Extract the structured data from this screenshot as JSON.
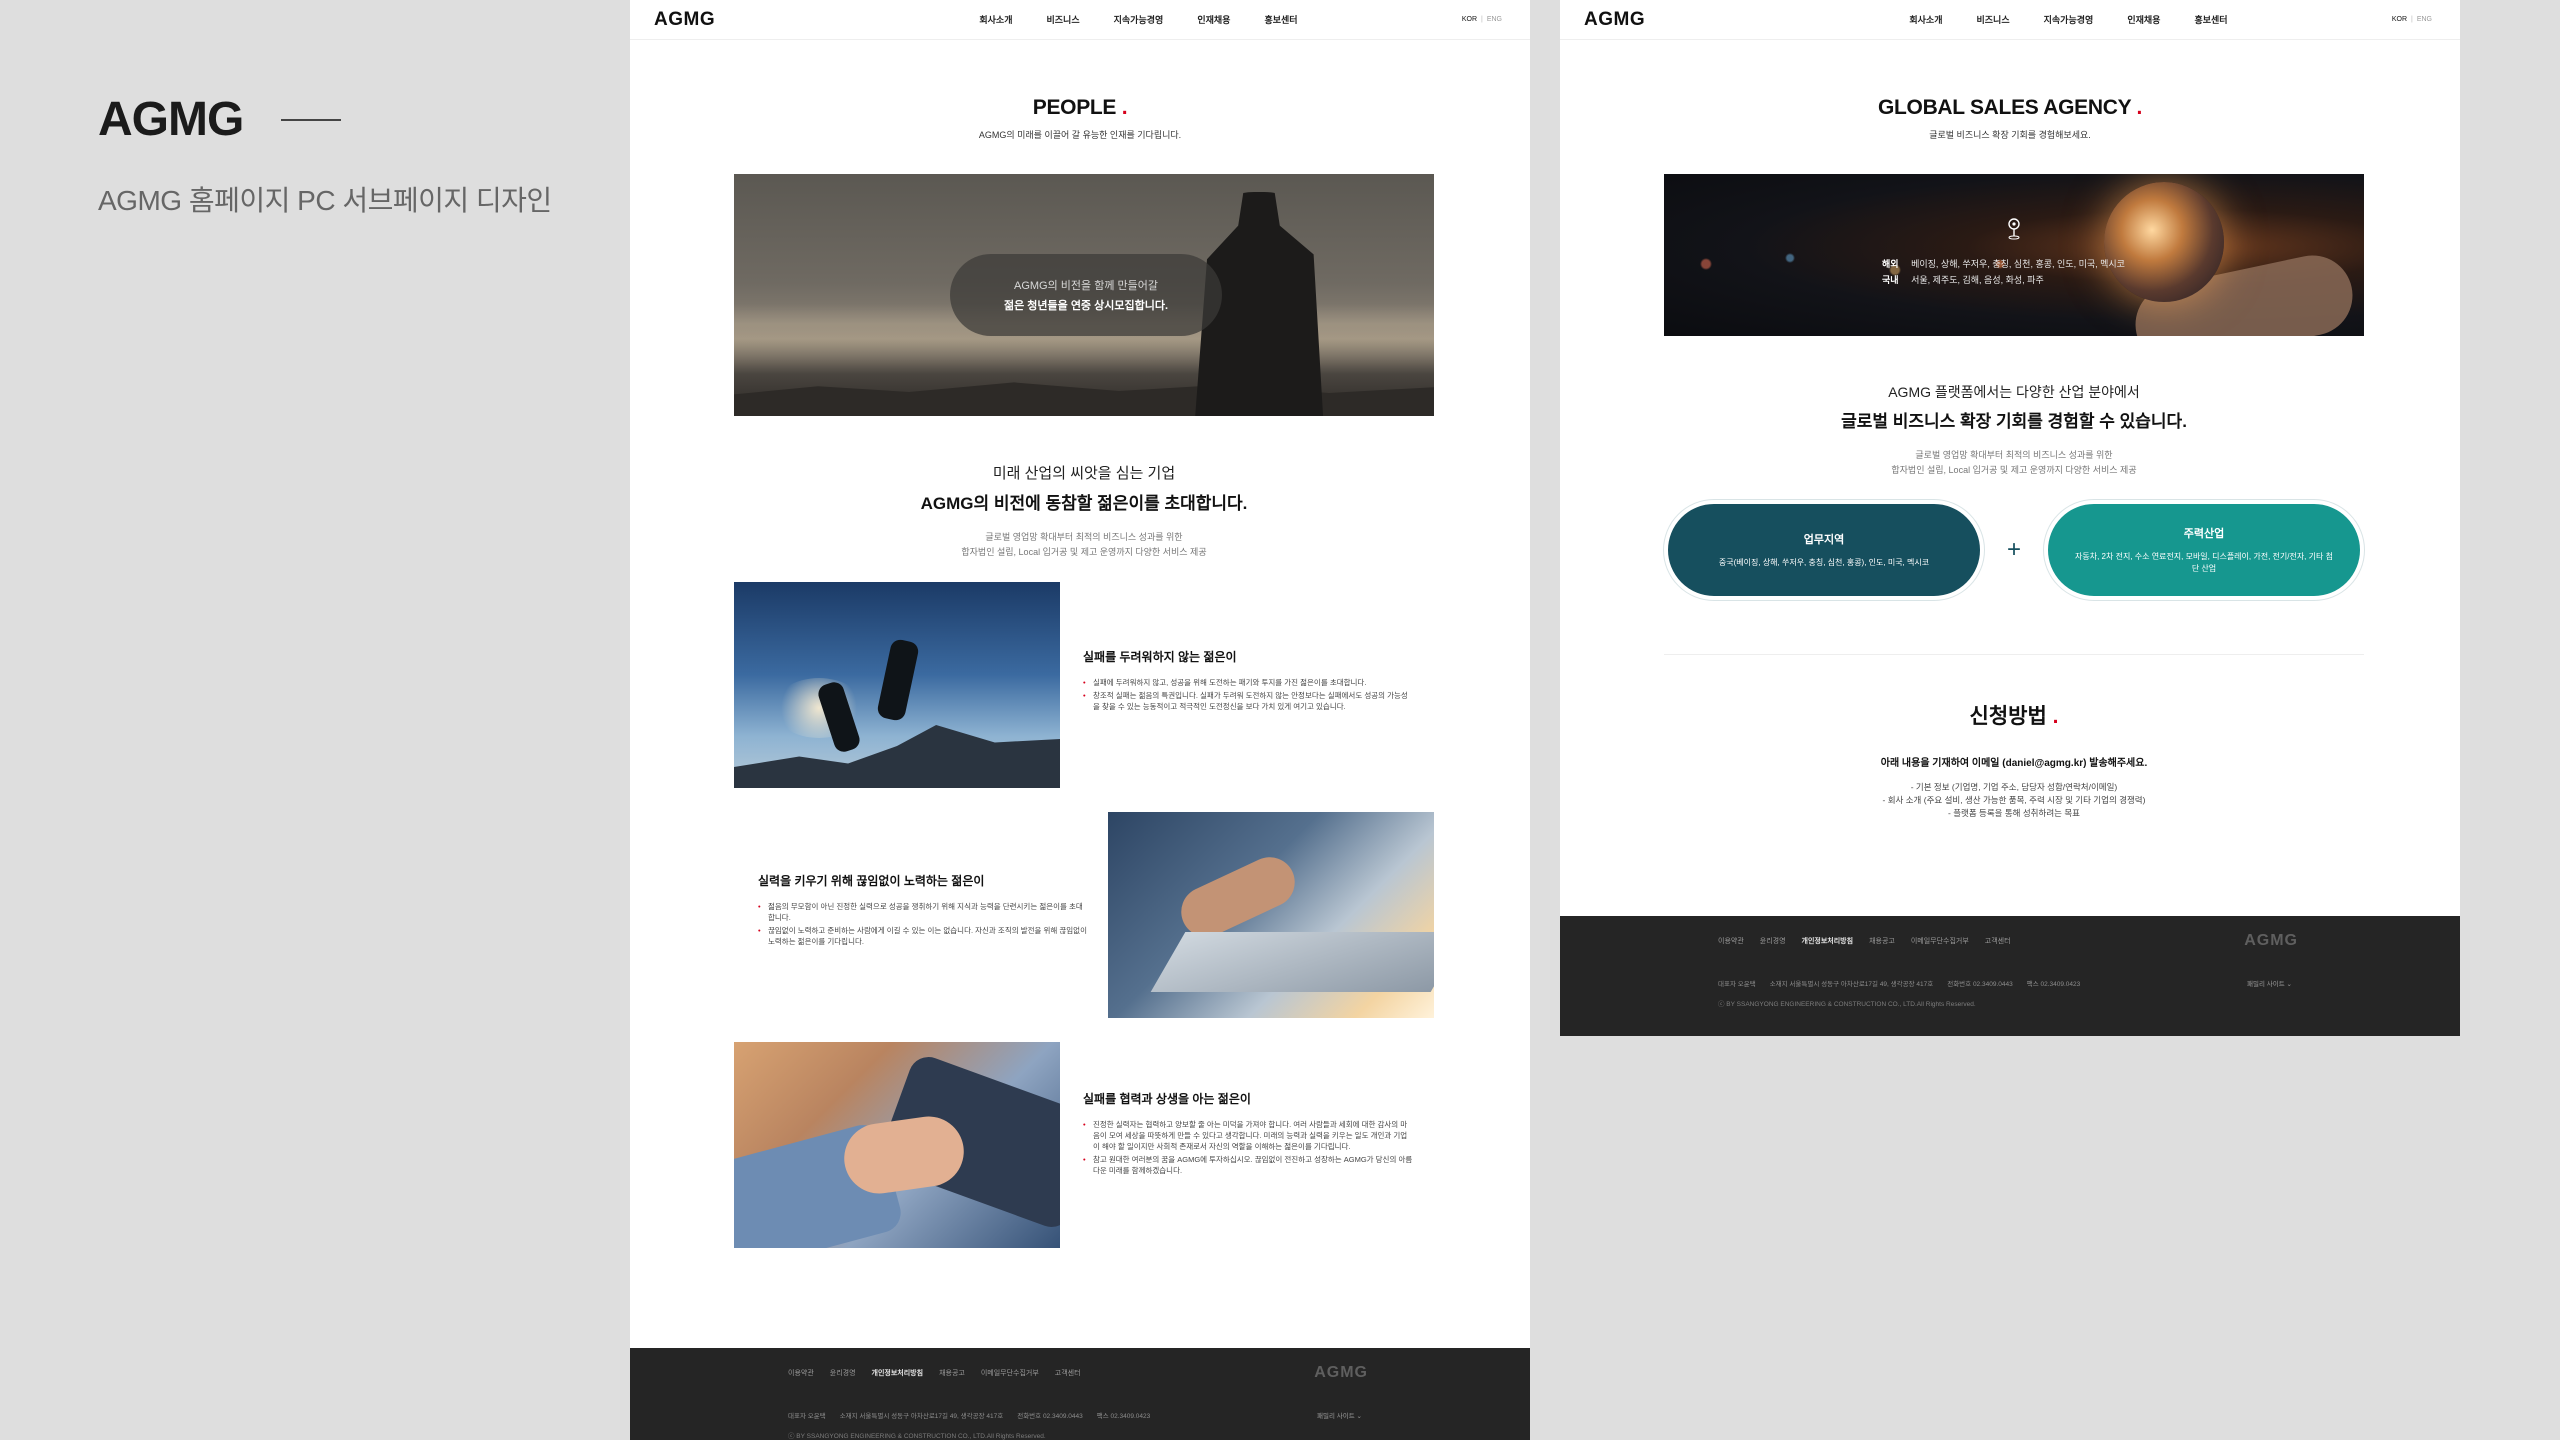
{
  "presentation": {
    "title": "AGMG",
    "subtitle": "AGMG 홈페이지 PC 서브페이지 디자인"
  },
  "header": {
    "logo": "AGMG",
    "nav": [
      "회사소개",
      "비즈니스",
      "지속가능경영",
      "인재채용",
      "홍보센터"
    ],
    "lang_kor": "KOR",
    "lang_sep": "|",
    "lang_eng": "ENG"
  },
  "page1": {
    "title": "PEOPLE",
    "title_dot": ".",
    "subtitle": "AGMG의 미래를 이끌어 갈 유능한 인재를 기다립니다.",
    "hero": {
      "line1": "AGMG의 비전을 함께 만들어갈",
      "line2": "젊은 청년들을 연중 상시모집합니다."
    },
    "intro": {
      "line1": "미래 산업의 씨앗을 심는 기업",
      "line2": "AGMG의 비전에 동참할 젊은이를 초대합니다.",
      "desc1": "글로벌 영업망 확대부터 최적의 비즈니스 성과를 위한",
      "desc2": "합자법인 설립, Local 입거공 및 제고 운영까지 다양한 서비스 제공"
    },
    "features": [
      {
        "title": "실패를 두려워하지 않는 젊은이",
        "bullets": [
          "실패에 두려워하지 않고, 성공을 위해 도전하는 패기와 투지를 가진 젊은이를 초대합니다.",
          "창조적 실패는 젊음의 특권입니다. 실패가 두려워 도전하지 않는 안정보다는 실패에서도 성공의 가능성을 찾을 수 있는 능동적이고 적극적인 도전정신을 보다 가치 있게 여기고 있습니다."
        ]
      },
      {
        "title": "실력을 키우기 위해 끊임없이 노력하는 젊은이",
        "bullets": [
          "젊음의 무모함이 아닌 진정한 실력으로 성공을 쟁취하기 위해 지식과 능력을 단련시키는 젊은이를 초대합니다.",
          "끊임없이 노력하고 준비하는 사람에게 이길 수 있는 이는 없습니다. 자신과 조직의 발전을 위해 끊임없이 노력하는 젊은이를 기다립니다."
        ]
      },
      {
        "title": "실패를 협력과 상생을 아는 젊은이",
        "bullets": [
          "진정한 실력자는 협력하고 양보할 줄 아는 미덕을 가져야 합니다. 여러 사람들과 세회에 대한 감사의 마음이 모여 세상을 따뜻하게 만들 수 있다고 생각합니다. 미래의 능력과 실력을 키우는 일도 개인과 기업이 해야 할 일이지만 사회적 존재로서 자신의 역할을 이해하는 젊은이를 기다립니다.",
          "참고 원대한 여러분의 꿈을 AGMG에 투자하십시오. 끊임없이 전진하고 성장하는 AGMG가 당신의 아름다운 미래를 함께하겠습니다."
        ]
      }
    ]
  },
  "page2": {
    "title": "GLOBAL SALES AGENCY",
    "title_dot": ".",
    "subtitle": "글로벌 비즈니스 확장 기회를 경험해보세요.",
    "hero": {
      "overseas_label": "해외",
      "overseas_value": "베이징, 상해, 쑤저우, 충칭, 심천, 홍콩, 인도, 미국, 멕시코",
      "domestic_label": "국내",
      "domestic_value": "서울, 제주도, 김해, 음성, 화성, 파주"
    },
    "intro": {
      "line1": "AGMG 플랫폼에서는 다양한 산업 분야에서",
      "line2": "글로벌 비즈니스 확장 기회를 경험할 수 있습니다.",
      "desc1": "글로벌 영업망 확대부터 최적의 비즈니스 성과를 위한",
      "desc2": "합자법인 설립, Local 입거공 및 제고 운영까지 다양한 서비스 제공"
    },
    "cta_region": {
      "title": "업무지역",
      "desc": "중국(베이징, 상해, 쑤저우, 충칭, 심천, 홍콩), 인도, 미국, 멕시코"
    },
    "plus": "+",
    "cta_industry": {
      "title": "주력산업",
      "desc": "자동차, 2차 전지, 수소 연료전지, 모바일, 디스플레이, 가전, 전기/전자, 기타 첨단 산업"
    },
    "apply": {
      "title": "신청방법",
      "title_dot": ".",
      "lead": "아래 내용을 기재하여 이메일 (daniel@agmg.kr) 발송해주세요.",
      "items": [
        "- 기본 정보 (기업명, 기업 주소, 담당자 성함/연락처/이메일)",
        "- 회사 소개 (주요 설비, 생산 가능한 품목, 주력 시장 및 기타 기업의 경쟁력)",
        "- 플랫폼 등록을 통해 성취하려는 목표"
      ]
    }
  },
  "footer": {
    "links": [
      "이용약관",
      "윤리경영",
      "개인정보처리방침",
      "채용공고",
      "이메일무단수집거부",
      "고객센터"
    ],
    "active_link": "개인정보처리방침",
    "logo": "AGMG",
    "info": [
      "대표자 오윤택",
      "소재지 서울특별시 성동구 아차산로17길 49, 생각공장 417호",
      "전화번호 02.3409.0443",
      "팩스 02.3409.0423"
    ],
    "copyright": "ⓒ BY SSANGYONG ENGINEERING & CONSTRUCTION CO., LTD.All Rights Reserved.",
    "family": "패밀리 사이트"
  }
}
